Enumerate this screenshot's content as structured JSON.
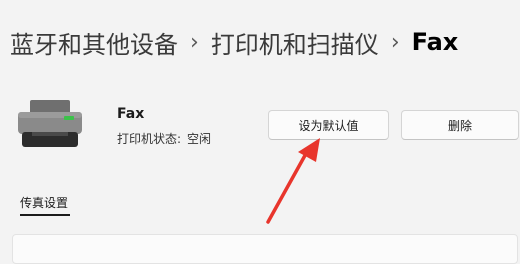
{
  "breadcrumb": {
    "items": [
      "蓝牙和其他设备",
      "打印机和扫描仪"
    ],
    "current": "Fax",
    "separator": "›"
  },
  "device": {
    "icon": "printer-icon",
    "name": "Fax",
    "status_label": "打印机状态:",
    "status_value": "空闲"
  },
  "actions": {
    "set_default_label": "设为默认值",
    "delete_label": "删除"
  },
  "tabs": [
    {
      "label": "传真设置",
      "selected": true
    }
  ],
  "colors": {
    "background": "#f3f3f3",
    "annotation_arrow": "#e8352c",
    "printer_light": "#3cc24a"
  }
}
